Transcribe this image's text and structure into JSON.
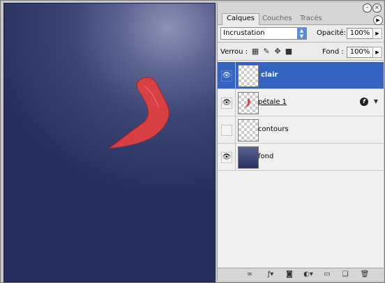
{
  "tabs": [
    "Calques",
    "Couches",
    "Tracés"
  ],
  "blend_mode": "Incrustation",
  "opacity_label": "Opacité:",
  "opacity_value": "100%",
  "lock_label": "Verrou :",
  "fill_label": "Fond :",
  "fill_value": "100%",
  "layers": [
    {
      "name": "clair",
      "visible": true,
      "selected": true
    },
    {
      "name": "pétale 1",
      "visible": true,
      "selected": false,
      "has_effects": true
    },
    {
      "name": "contours",
      "visible": false,
      "selected": false
    },
    {
      "name": "fond",
      "visible": true,
      "selected": false
    }
  ],
  "colors": {
    "selection": "#3563c2",
    "petal": "#e14040",
    "background_top": "#8e93b4",
    "background_bottom": "#26305e"
  },
  "icons": {
    "lock": [
      "lock-transparency-icon",
      "lock-paint-icon",
      "lock-move-icon",
      "lock-all-icon"
    ],
    "bottom": [
      "link-icon",
      "layer-style-icon",
      "mask-icon",
      "adjustment-layer-icon",
      "group-icon",
      "new-layer-icon",
      "trash-icon"
    ]
  }
}
